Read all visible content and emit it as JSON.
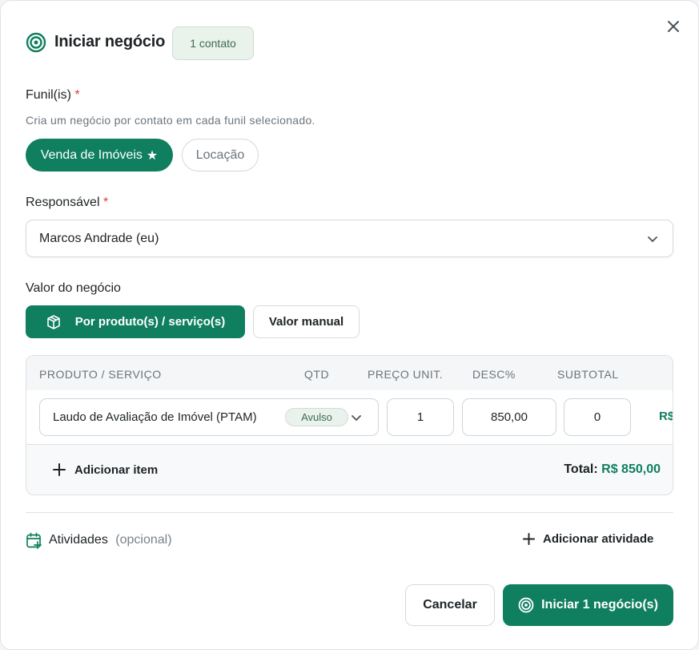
{
  "header": {
    "title": "Iniciar negócio",
    "badge": "1 contato",
    "icon": "target-icon",
    "close_icon": "close-icon"
  },
  "funnels": {
    "label": "Funil(is)",
    "required_mark": "*",
    "hint": "Cria um negócio por contato em cada funil selecionado.",
    "options": [
      {
        "label": "Venda de Imóveis",
        "selected": true,
        "star": "★"
      },
      {
        "label": "Locação",
        "selected": false
      }
    ]
  },
  "responsible": {
    "label": "Responsável",
    "required_mark": "*",
    "value": "Marcos Andrade (eu)"
  },
  "deal_value": {
    "label": "Valor do negócio",
    "modes": [
      {
        "label": "Por produto(s) / serviço(s)",
        "selected": true,
        "icon": "package-icon"
      },
      {
        "label": "Valor manual",
        "selected": false
      }
    ]
  },
  "products": {
    "columns": [
      "PRODUTO / SERVIÇO",
      "QTD",
      "PREÇO UNIT.",
      "DESC%",
      "SUBTOTAL"
    ],
    "rows": [
      {
        "product": "Laudo de Avaliação de Imóvel (PTAM)",
        "tag": "Avulso",
        "qty": "1",
        "unit_price": "850,00",
        "discount": "0",
        "subtotal": "R$"
      }
    ],
    "add_item_label": "Adicionar item",
    "total_label": "Total:",
    "total_value": "R$ 850,00"
  },
  "activities": {
    "label": "Atividades",
    "optional": "(opcional)",
    "add_label": "Adicionar atividade"
  },
  "footer": {
    "cancel_label": "Cancelar",
    "submit_label": "Iniciar 1 negócio(s)"
  },
  "colors": {
    "primary": "#0f7f5f",
    "required": "#e23b3b",
    "badge_bg": "#eaf2ec"
  }
}
